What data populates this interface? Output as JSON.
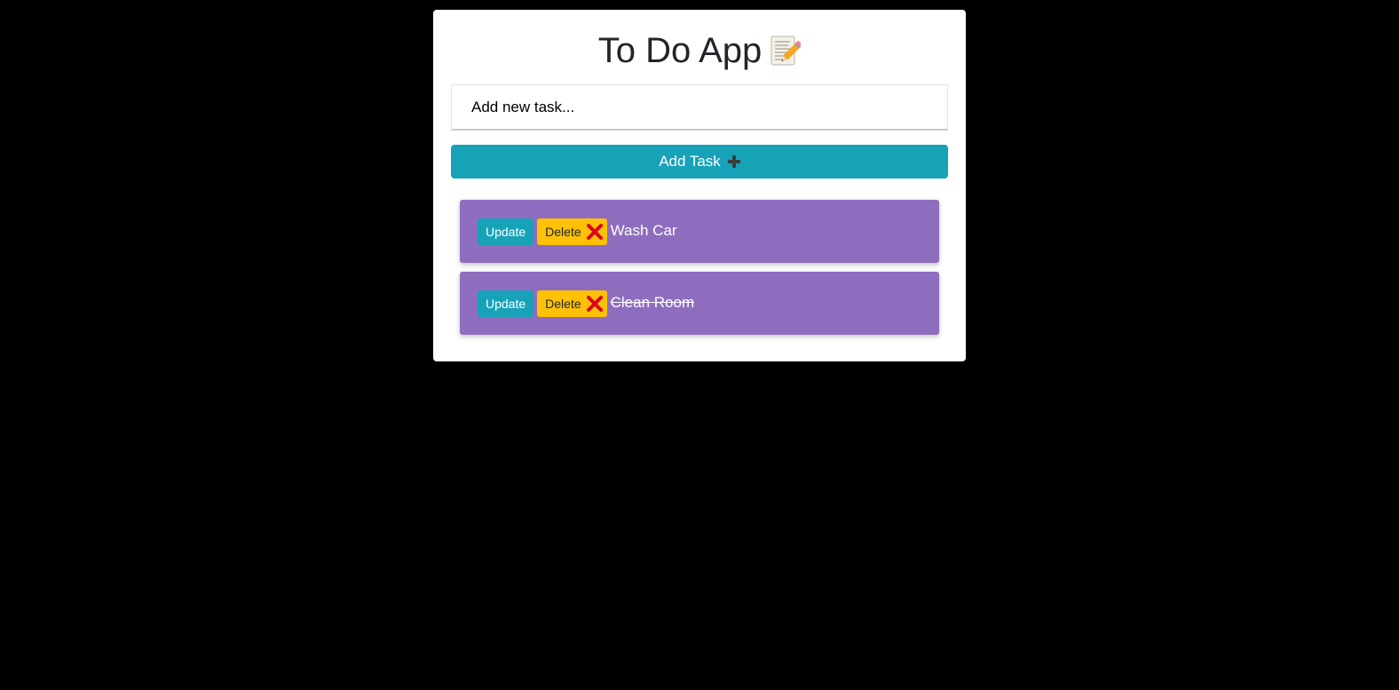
{
  "app": {
    "title": "To Do App",
    "title_icon": "memo-icon"
  },
  "input": {
    "value": "",
    "placeholder": "Add new task..."
  },
  "add_button": {
    "label": "Add Task",
    "icon": "plus-icon"
  },
  "tasks": [
    {
      "text": "Wash Car",
      "completed": false,
      "update_label": "Update",
      "delete_label": "Delete"
    },
    {
      "text": "Clean Room",
      "completed": true,
      "update_label": "Update",
      "delete_label": "Delete"
    }
  ],
  "colors": {
    "background": "#000000",
    "card": "#ffffff",
    "accent": "#17a2b8",
    "warning": "#ffc107",
    "task_bg": "#8e6dbf",
    "delete_icon": "#e0001b"
  }
}
